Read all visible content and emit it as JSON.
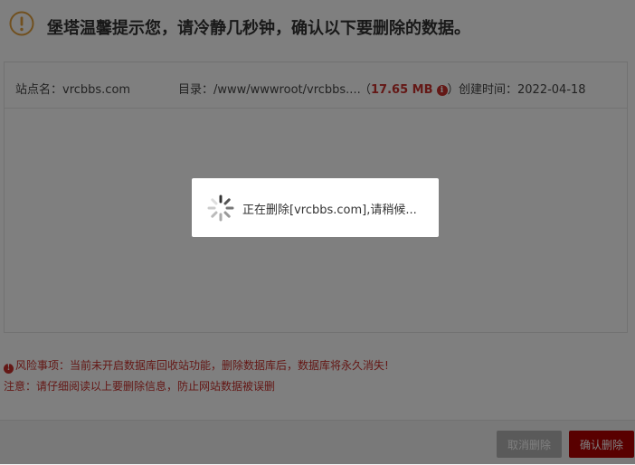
{
  "header": {
    "title": "堡塔温馨提示您，请冷静几秒钟，确认以下要删除的数据。",
    "icon": "warning-circle-icon",
    "icon_color": "#e2a13f"
  },
  "site_info": {
    "site_name": "站点名：vrcbbs.com",
    "directory": "目录：/www/wwwroot/vrcbbs....",
    "size_open": "（",
    "size": "17.65 MB",
    "size_close": "）",
    "info_icon_glyph": "i",
    "created": "创建时间：2022-04-18"
  },
  "warnings": {
    "risk_glyph": "!",
    "risk": "风险事项：当前未开启数据库回收站功能，删除数据库后，数据库将永久消失!",
    "note": "注意：请仔细阅读以上要删除信息，防止网站数据被误删"
  },
  "footer": {
    "cancel_label": "取消删除",
    "confirm_label": "确认删除"
  },
  "loading": {
    "text": "正在删除[vrcbbs.com],请稍候...",
    "icon": "spinner-icon"
  },
  "colors": {
    "danger": "#c9302c",
    "confirm_button": "#b30000",
    "cancel_button": "#b4b4b4"
  }
}
